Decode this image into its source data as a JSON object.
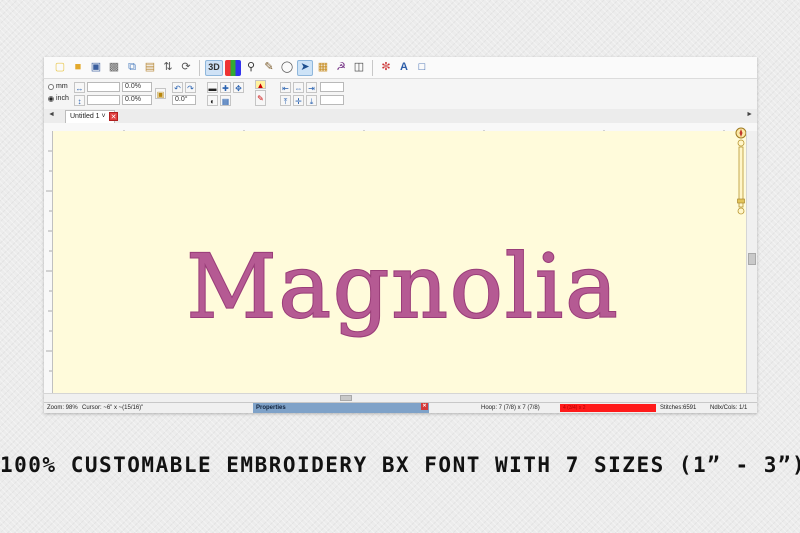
{
  "window": {
    "tab_label": "Untitled 1 ˅",
    "nav_left": "◄",
    "nav_right": "►"
  },
  "toolbar_main": {
    "label_3d": "3D",
    "icons": [
      "new-file-icon",
      "open-folder-icon",
      "save-icon",
      "print-icon",
      "copy-icon",
      "paste-icon",
      "flip-icon",
      "transform-icon",
      "3d-view-icon",
      "color-swatch-icon",
      "zoom-icon",
      "measure-icon",
      "hoop-icon",
      "select-arrow-icon",
      "grid-icon",
      "thread-icon",
      "stitch-icon",
      "color-wheel-icon",
      "lettering-icon",
      "embroidery-icon"
    ]
  },
  "toolbar_props": {
    "unit_mm_label": "mm",
    "unit_inch_label": "inch",
    "selected_unit": "inch",
    "width_value": "",
    "width_percent": "0.0%",
    "height_value": "",
    "height_percent": "0.0%",
    "angle_value": "0.0°"
  },
  "canvas": {
    "wordmark": "Magnolia",
    "background_color": "#fffbdb",
    "stitch_color": "#b55a93"
  },
  "status": {
    "zoom": "Zoom: 98%",
    "cursor": "Cursor: ~6\" x ~(15/16)\"",
    "properties_label": "Properties",
    "hoop": "Hoop: 7 (7/8) x 7 (7/8)",
    "red_segment_text": "4 (3/4) x 2",
    "stitches": "Stitches:6591",
    "ndlx_cols": "Ndlx/Cols: 1/1"
  },
  "caption": "100% CUSTOMABLE EMBROIDERY BX FONT WITH 7 SIZES (1” -  3”)"
}
